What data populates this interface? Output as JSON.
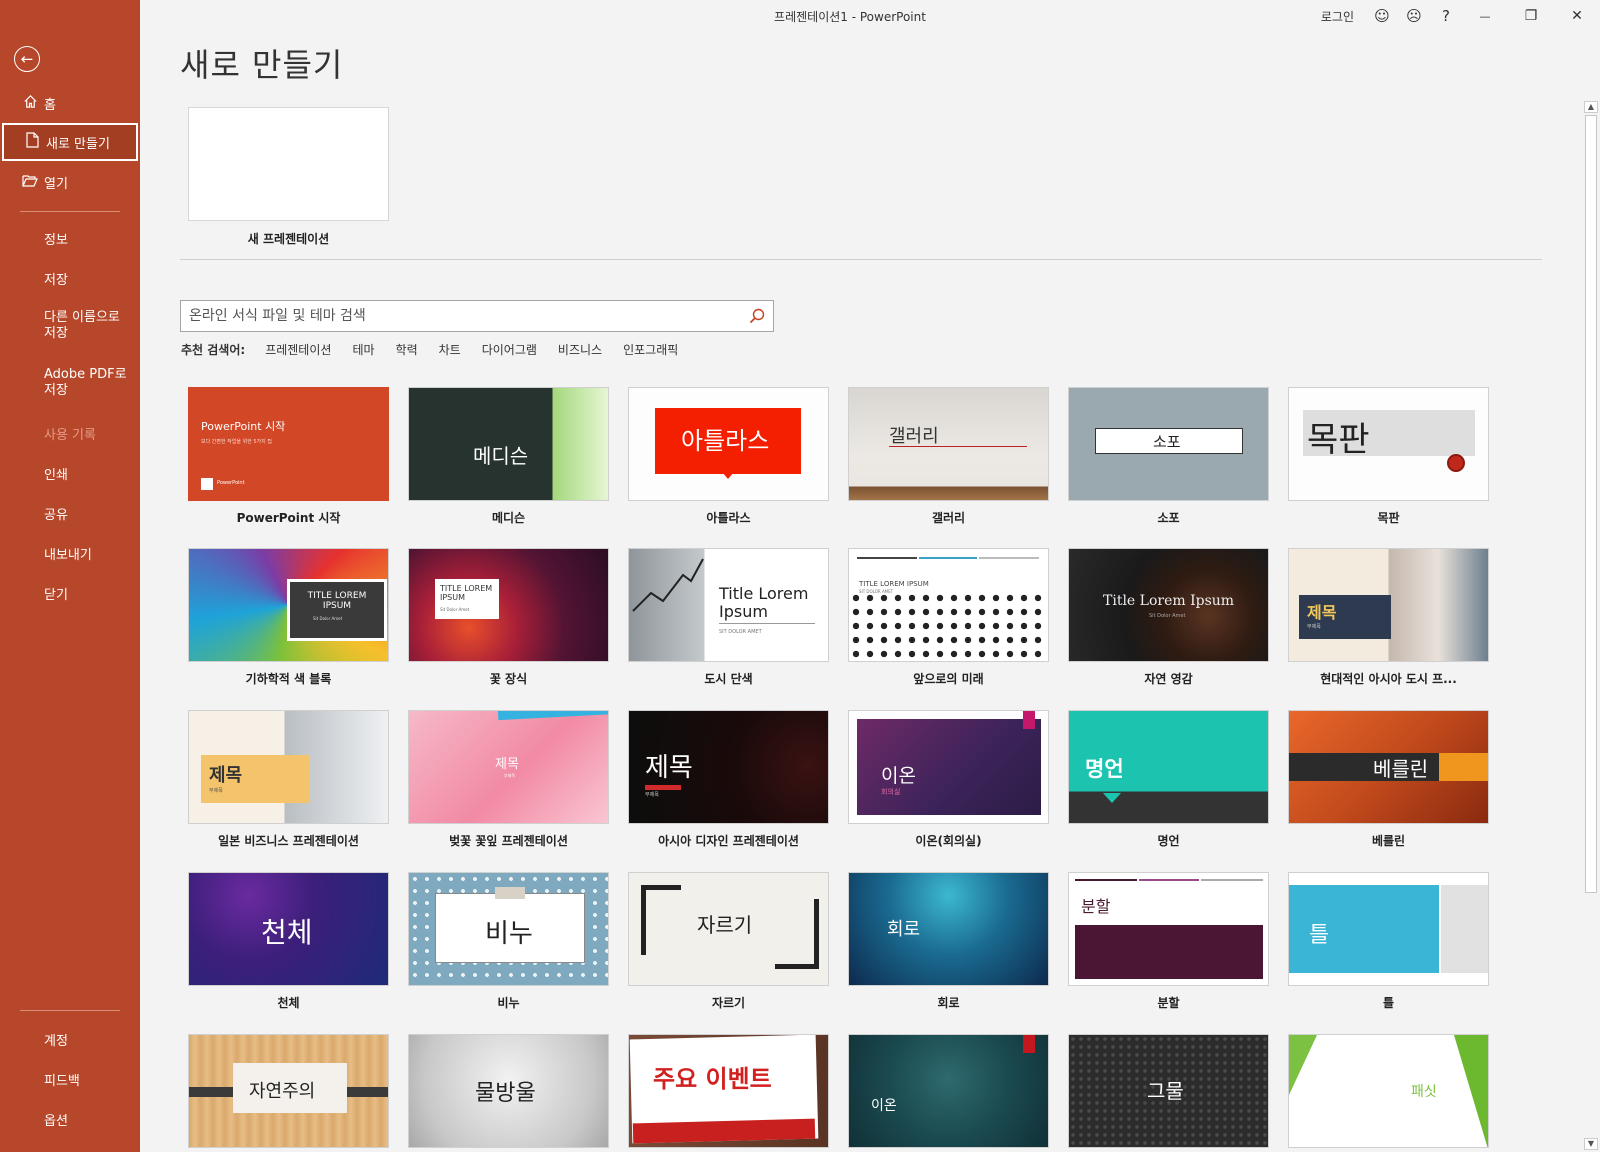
{
  "window": {
    "title": "프레젠테이션1  -  PowerPoint",
    "signin": "로그인",
    "smile_icon": "☺",
    "frown_icon": "☹",
    "help_icon": "?",
    "minimize_icon": "—",
    "restore_icon": "❐",
    "close_icon": "✕"
  },
  "sidebar": {
    "back_icon": "←",
    "home": "홈",
    "new": "새로 만들기",
    "open": "열기",
    "info": "정보",
    "save": "저장",
    "save_as": "다른 이름으로\n저장",
    "save_pdf": "Adobe PDF로\n저장",
    "history": "사용 기록",
    "print": "인쇄",
    "share": "공유",
    "export": "내보내기",
    "close": "닫기",
    "account": "계정",
    "feedback": "피드백",
    "options": "옵션"
  },
  "main": {
    "title": "새로 만들기",
    "blank_label": "새 프레젠테이션",
    "search_placeholder": "온라인 서식 파일 및 테마 검색",
    "suggest_label": "추천 검색어:",
    "suggested": [
      "프레젠테이션",
      "테마",
      "학력",
      "차트",
      "다이어그램",
      "비즈니스",
      "인포그래픽"
    ]
  },
  "templates": {
    "t1": {
      "name": "PowerPoint 시작",
      "thumb_title": "PowerPoint 시작",
      "thumb_sub": "보다 간편한 작업을 위한 5가지 팁",
      "thumb_brand": "PowerPoint"
    },
    "t2": {
      "name": "메디슨",
      "thumb_title": "메디슨"
    },
    "t3": {
      "name": "아틀라스",
      "thumb_title": "아틀라스"
    },
    "t4": {
      "name": "갤러리",
      "thumb_title": "갤러리"
    },
    "t5": {
      "name": "소포",
      "thumb_title": "소포"
    },
    "t6": {
      "name": "목판",
      "thumb_title": "목판"
    },
    "t7": {
      "name": "기하학적 색 블록",
      "thumb_title": "TITLE LOREM\nIPSUM",
      "thumb_sub": "Sit Dolor Amet"
    },
    "t8": {
      "name": "꽃 장식",
      "thumb_title": "TITLE LOREM\nIPSUM",
      "thumb_sub": "Sit Dolor Amet"
    },
    "t9": {
      "name": "도시 단색",
      "thumb_title": "Title Lorem\nIpsum",
      "thumb_sub": "SIT DOLOR AMET"
    },
    "t10": {
      "name": "앞으로의 미래",
      "thumb_title": "TITLE LOREM IPSUM",
      "thumb_sub": "SIT DOLOR AMET"
    },
    "t11": {
      "name": "자연 영감",
      "thumb_title": "Title Lorem Ipsum",
      "thumb_sub": "Sit Dolor Amet"
    },
    "t12": {
      "name": "현대적인 아시아 도시 프...",
      "thumb_title": "제목",
      "thumb_sub": "부제목"
    },
    "t13": {
      "name": "일본 비즈니스 프레젠테이션",
      "thumb_title": "제목",
      "thumb_sub": "부제목"
    },
    "t14": {
      "name": "벚꽃 꽃잎 프레젠테이션",
      "thumb_title": "제목",
      "thumb_sub": "부제목"
    },
    "t15": {
      "name": "아시아 디자인 프레젠테이션",
      "thumb_title": "제목",
      "thumb_sub": "부제목"
    },
    "t16": {
      "name": "이온(회의실)",
      "thumb_title": "이온",
      "thumb_sub": "회의실"
    },
    "t17": {
      "name": "명언",
      "thumb_title": "명언"
    },
    "t18": {
      "name": "베를린",
      "thumb_title": "베를린"
    },
    "t19": {
      "name": "천체",
      "thumb_title": "천체"
    },
    "t20": {
      "name": "비누",
      "thumb_title": "비누"
    },
    "t21": {
      "name": "자르기",
      "thumb_title": "자르기"
    },
    "t22": {
      "name": "회로",
      "thumb_title": "회로"
    },
    "t23": {
      "name": "분할",
      "thumb_title": "분할"
    },
    "t24": {
      "name": "틀",
      "thumb_title": "틀"
    },
    "t25": {
      "thumb_title": "자연주의"
    },
    "t26": {
      "thumb_title": "물방울"
    },
    "t27": {
      "thumb_title": "주요 이벤트"
    },
    "t28": {
      "thumb_title": "이온"
    },
    "t29": {
      "thumb_title": "그물"
    },
    "t30": {
      "thumb_title": "패싯"
    }
  },
  "colors": {
    "sidebar": "#b7472a",
    "accent": "#c43e1c"
  }
}
